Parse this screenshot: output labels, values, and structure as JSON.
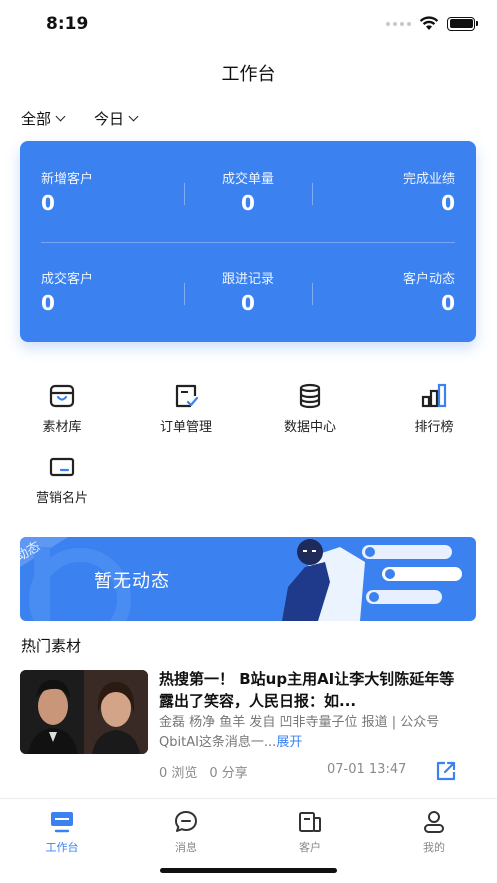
{
  "status_bar": {
    "time": "8:19"
  },
  "header": {
    "title": "工作台"
  },
  "filters": {
    "scope": "全部",
    "period": "今日"
  },
  "stats": [
    {
      "label": "新增客户",
      "value": "0"
    },
    {
      "label": "成交单量",
      "value": "0"
    },
    {
      "label": "完成业绩",
      "value": "0"
    },
    {
      "label": "成交客户",
      "value": "0"
    },
    {
      "label": "跟进记录",
      "value": "0"
    },
    {
      "label": "客户动态",
      "value": "0"
    }
  ],
  "menu": [
    {
      "label": "素材库",
      "icon": "material-library-icon"
    },
    {
      "label": "订单管理",
      "icon": "order-management-icon"
    },
    {
      "label": "数据中心",
      "icon": "database-icon"
    },
    {
      "label": "排行榜",
      "icon": "ranking-icon"
    },
    {
      "label": "营销名片",
      "icon": "business-card-icon"
    }
  ],
  "banner": {
    "tag": "动态",
    "text": "暂无动态"
  },
  "hot_section": {
    "title": "热门素材"
  },
  "article": {
    "title": "热搜第一！ B站up主用AI让李大钊陈延年等露出了笑容，人民日报：如...",
    "summary": "金磊 杨净 鱼羊 发自 凹非寺量子位 报道 | 公众号 QbitAI这条消息一...",
    "expand_label": "展开",
    "views": "0 浏览",
    "shares": "0 分享",
    "date": "07-01 13:47"
  },
  "tabs": [
    {
      "label": "工作台",
      "active": true
    },
    {
      "label": "消息",
      "active": false
    },
    {
      "label": "客户",
      "active": false
    },
    {
      "label": "我的",
      "active": false
    }
  ],
  "colors": {
    "accent": "#3b82f0",
    "text": "#222222",
    "muted": "#888888"
  }
}
